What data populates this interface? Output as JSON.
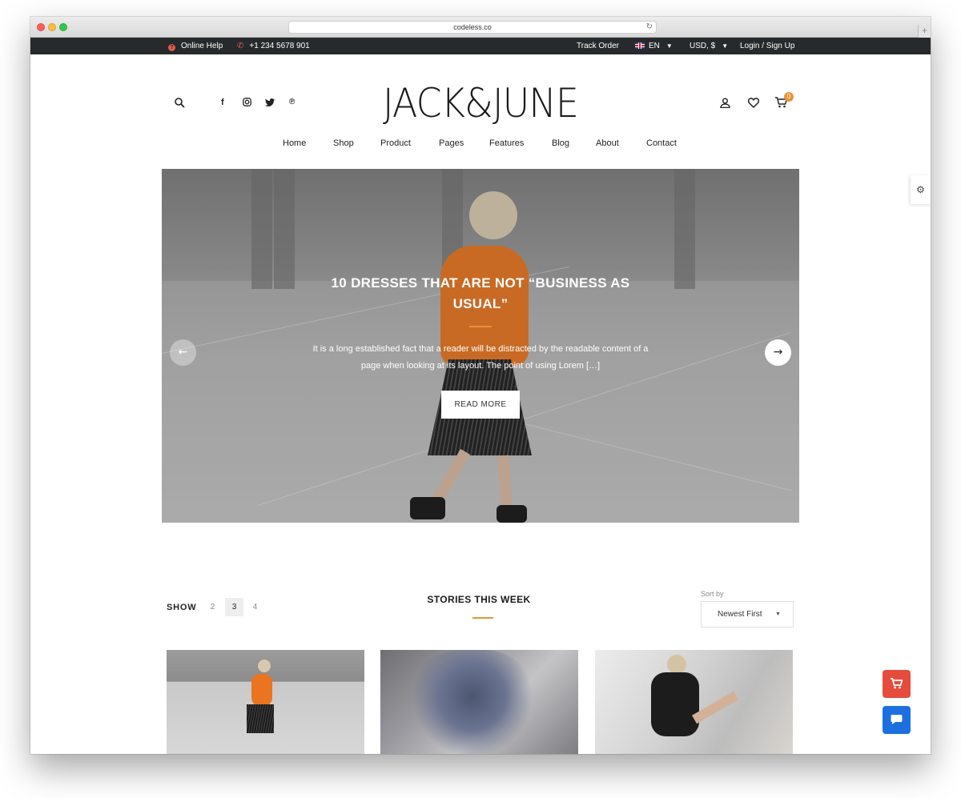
{
  "browser": {
    "url": "codeless.co"
  },
  "topbar": {
    "online_help": "Online Help",
    "phone": "+1 234 5678 901",
    "track_order": "Track Order",
    "language": "EN",
    "currency": "USD, $",
    "login": "Login / Sign Up"
  },
  "header": {
    "logo": "JACK&JUNE",
    "cart_count": "0",
    "social": [
      "facebook",
      "instagram",
      "twitter",
      "pinterest"
    ]
  },
  "nav": {
    "items": [
      "Home",
      "Shop",
      "Product",
      "Pages",
      "Features",
      "Blog",
      "About",
      "Contact"
    ]
  },
  "hero": {
    "title": "10 DRESSES THAT ARE NOT “BUSINESS AS USUAL”",
    "text": "It is a long established fact that a reader will be distracted by the readable content of a page when looking at its layout. The point of using Lorem […]",
    "button": "READ MORE"
  },
  "stories": {
    "show_label": "SHOW",
    "show_options": [
      "2",
      "3",
      "4"
    ],
    "show_selected": "3",
    "title": "STORIES THIS WEEK",
    "sort_label": "Sort by",
    "sort_value": "Newest First"
  },
  "colors": {
    "accent": "#e8923a",
    "topbar": "#262a2c",
    "cart_fab": "#e54c3c",
    "chat_fab": "#1d6fe0"
  },
  "icons": [
    "help-icon",
    "phone-icon",
    "search-icon",
    "user-icon",
    "heart-icon",
    "cart-icon",
    "settings-icon",
    "chat-icon"
  ]
}
